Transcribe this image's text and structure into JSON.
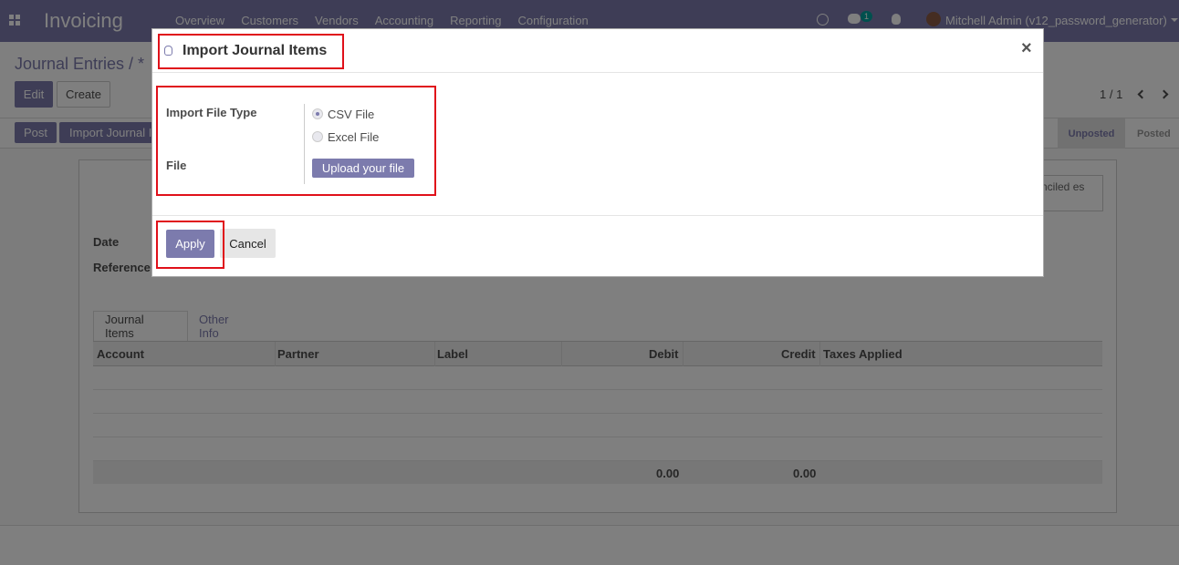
{
  "navbar": {
    "brand": "Invoicing",
    "menu": [
      "Overview",
      "Customers",
      "Vendors",
      "Accounting",
      "Reporting",
      "Configuration"
    ],
    "messages_count": "1",
    "user": "Mitchell Admin (v12_password_generator)",
    "accent": "#7c7bad"
  },
  "control_panel": {
    "breadcrumb": "Journal Entries / *",
    "edit_label": "Edit",
    "create_label": "Create",
    "pager": "1 / 1"
  },
  "statusbar": {
    "post_label": "Post",
    "import_label": "Import Journal I",
    "stages": [
      "Unposted",
      "Posted"
    ]
  },
  "form": {
    "date_label": "Date",
    "reference_label": "Reference",
    "smart_button": "nciled es",
    "tabs": [
      "Journal Items",
      "Other Info"
    ],
    "columns": [
      "Account",
      "Partner",
      "Label",
      "Debit",
      "Credit",
      "Taxes Applied"
    ],
    "totals": {
      "debit": "0.00",
      "credit": "0.00"
    }
  },
  "modal": {
    "title": "Import Journal Items",
    "close": "×",
    "import_type_label": "Import File Type",
    "options": [
      "CSV File",
      "Excel File"
    ],
    "selected_option": "CSV File",
    "file_label": "File",
    "upload_label": "Upload your file",
    "apply_label": "Apply",
    "cancel_label": "Cancel"
  }
}
